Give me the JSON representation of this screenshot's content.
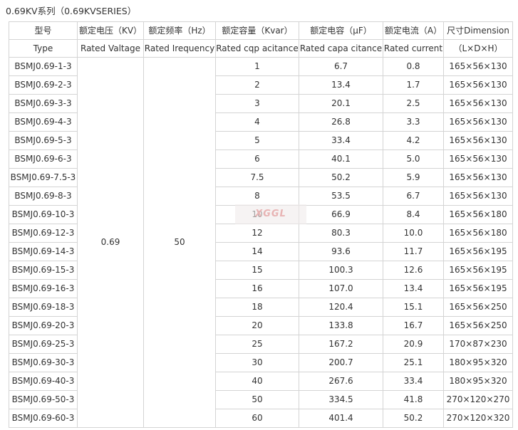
{
  "caption": "0.69KV系列（0.69KVSERIES）",
  "headers": [
    {
      "cn": "型号",
      "en": "Type"
    },
    {
      "cn": "额定电压（KV）",
      "en": "Rated Valtage"
    },
    {
      "cn": "额定频率（Hz）",
      "en": "Rated Irequency"
    },
    {
      "cn": "额定容量（Kvar）",
      "en": "Rated cqp acitance"
    },
    {
      "cn": "额定电容（μF）",
      "en": "Rated capa citance"
    },
    {
      "cn": "额定电流（A）",
      "en": "Rated current"
    },
    {
      "cn": "尺寸Dimension",
      "en": "（L×D×H）"
    }
  ],
  "shared": {
    "voltage": "0.69",
    "frequency": "50"
  },
  "rows": [
    {
      "type": "BSMJ0.69-1-3",
      "capacity": "1",
      "capacitance": "6.7",
      "current": "0.8",
      "dimension": "165×56×130"
    },
    {
      "type": "BSMJ0.69-2-3",
      "capacity": "2",
      "capacitance": "13.4",
      "current": "1.7",
      "dimension": "165×56×130"
    },
    {
      "type": "BSMJ0.69-3-3",
      "capacity": "3",
      "capacitance": "20.1",
      "current": "2.5",
      "dimension": "165×56×130"
    },
    {
      "type": "BSMJ0.69-4-3",
      "capacity": "4",
      "capacitance": "26.8",
      "current": "3.3",
      "dimension": "165×56×130"
    },
    {
      "type": "BSMJ0.69-5-3",
      "capacity": "5",
      "capacitance": "33.4",
      "current": "4.2",
      "dimension": "165×56×130"
    },
    {
      "type": "BSMJ0.69-6-3",
      "capacity": "6",
      "capacitance": "40.1",
      "current": "5.0",
      "dimension": "165×56×130"
    },
    {
      "type": "BSMJ0.69-7.5-3",
      "capacity": "7.5",
      "capacitance": "50.2",
      "current": "5.9",
      "dimension": "165×56×130"
    },
    {
      "type": "BSMJ0.69-8-3",
      "capacity": "8",
      "capacitance": "53.5",
      "current": "6.7",
      "dimension": "165×56×130"
    },
    {
      "type": "BSMJ0.69-10-3",
      "capacity": "10",
      "capacitance": "66.9",
      "current": "8.4",
      "dimension": "165×56×180"
    },
    {
      "type": "BSMJ0.69-12-3",
      "capacity": "12",
      "capacitance": "80.3",
      "current": "10.0",
      "dimension": "165×56×180"
    },
    {
      "type": "BSMJ0.69-14-3",
      "capacity": "14",
      "capacitance": "93.6",
      "current": "11.7",
      "dimension": "165×56×195"
    },
    {
      "type": "BSMJ0.69-15-3",
      "capacity": "15",
      "capacitance": "100.3",
      "current": "12.6",
      "dimension": "165×56×195"
    },
    {
      "type": "BSMJ0.69-16-3",
      "capacity": "16",
      "capacitance": "107.0",
      "current": "13.4",
      "dimension": "165×56×195"
    },
    {
      "type": "BSMJ0.69-18-3",
      "capacity": "18",
      "capacitance": "120.4",
      "current": "15.1",
      "dimension": "165×56×250"
    },
    {
      "type": "BSMJ0.69-20-3",
      "capacity": "20",
      "capacitance": "133.8",
      "current": "16.7",
      "dimension": "165×56×250"
    },
    {
      "type": "BSMJ0.69-25-3",
      "capacity": "25",
      "capacitance": "167.2",
      "current": "20.9",
      "dimension": "170×87×230"
    },
    {
      "type": "BSMJ0.69-30-3",
      "capacity": "30",
      "capacitance": "200.7",
      "current": "25.1",
      "dimension": "180×95×320"
    },
    {
      "type": "BSMJ0.69-40-3",
      "capacity": "40",
      "capacitance": "267.6",
      "current": "33.4",
      "dimension": "180×95×320"
    },
    {
      "type": "BSMJ0.69-50-3",
      "capacity": "50",
      "capacitance": "334.5",
      "current": "41.8",
      "dimension": "270×120×270"
    },
    {
      "type": "BSMJ0.69-60-3",
      "capacity": "60",
      "capacitance": "401.4",
      "current": "50.2",
      "dimension": "270×120×320"
    }
  ],
  "watermark": "XGGL"
}
